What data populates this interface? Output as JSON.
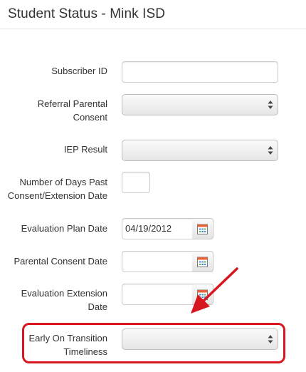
{
  "page": {
    "title": "Student Status - Mink ISD"
  },
  "fields": {
    "subscriber_id": {
      "label": "Subscriber ID",
      "value": ""
    },
    "referral_parental_consent": {
      "label": "Referral Parental Consent",
      "value": ""
    },
    "iep_result": {
      "label": "IEP Result",
      "value": ""
    },
    "days_past": {
      "label": "Number of Days Past Consent/Extension Date",
      "value": ""
    },
    "evaluation_plan_date": {
      "label": "Evaluation Plan Date",
      "value": "04/19/2012"
    },
    "parental_consent_date": {
      "label": "Parental Consent Date",
      "value": ""
    },
    "evaluation_extension_date": {
      "label": "Evaluation Extension Date",
      "value": ""
    },
    "early_on_transition": {
      "label": "Early On Transition Timeliness",
      "value": ""
    }
  },
  "icons": {
    "calendar": "calendar-icon",
    "select_arrows": "updown-arrows-icon",
    "annotation_arrow": "red-arrow-icon"
  },
  "colors": {
    "highlight": "#d8161f",
    "arrow": "#d8161f"
  }
}
